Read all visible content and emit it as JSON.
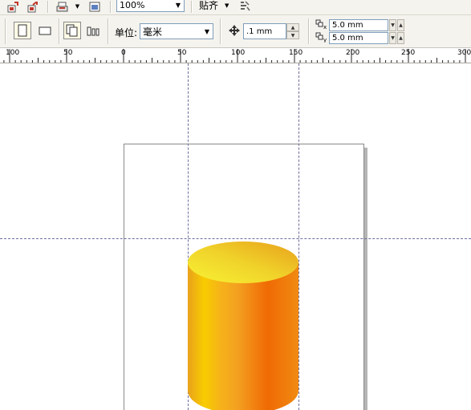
{
  "toolbar": {
    "zoom_value": "100%",
    "snap_label": "贴齐",
    "unit_label": "单位:",
    "unit_value": "毫米",
    "nudge_value": ".1 mm",
    "dup_x_value": "5.0 mm",
    "dup_y_value": "5.0 mm",
    "icons": [
      "import-icon",
      "export-icon",
      "print-icon",
      "zoom-dropdown-arrow",
      "application-launcher-icon",
      "options-icon",
      "portrait-icon",
      "landscape-icon",
      "all-pages-icon",
      "current-page-icon",
      "nudge-icon",
      "duplicate-x-icon",
      "duplicate-y-icon"
    ]
  },
  "ruler": {
    "labels": [
      "100",
      "50",
      "0",
      "50",
      "100",
      "150",
      "200",
      "250",
      "300"
    ]
  },
  "canvas": {
    "object": "cylinder",
    "colors": {
      "top_light": "#f7ef3a",
      "top_dark": "#e9a11a",
      "body_orange": "#f07a0a",
      "body_yellow": "#f6c600",
      "guide": "#6e6e9e"
    }
  }
}
